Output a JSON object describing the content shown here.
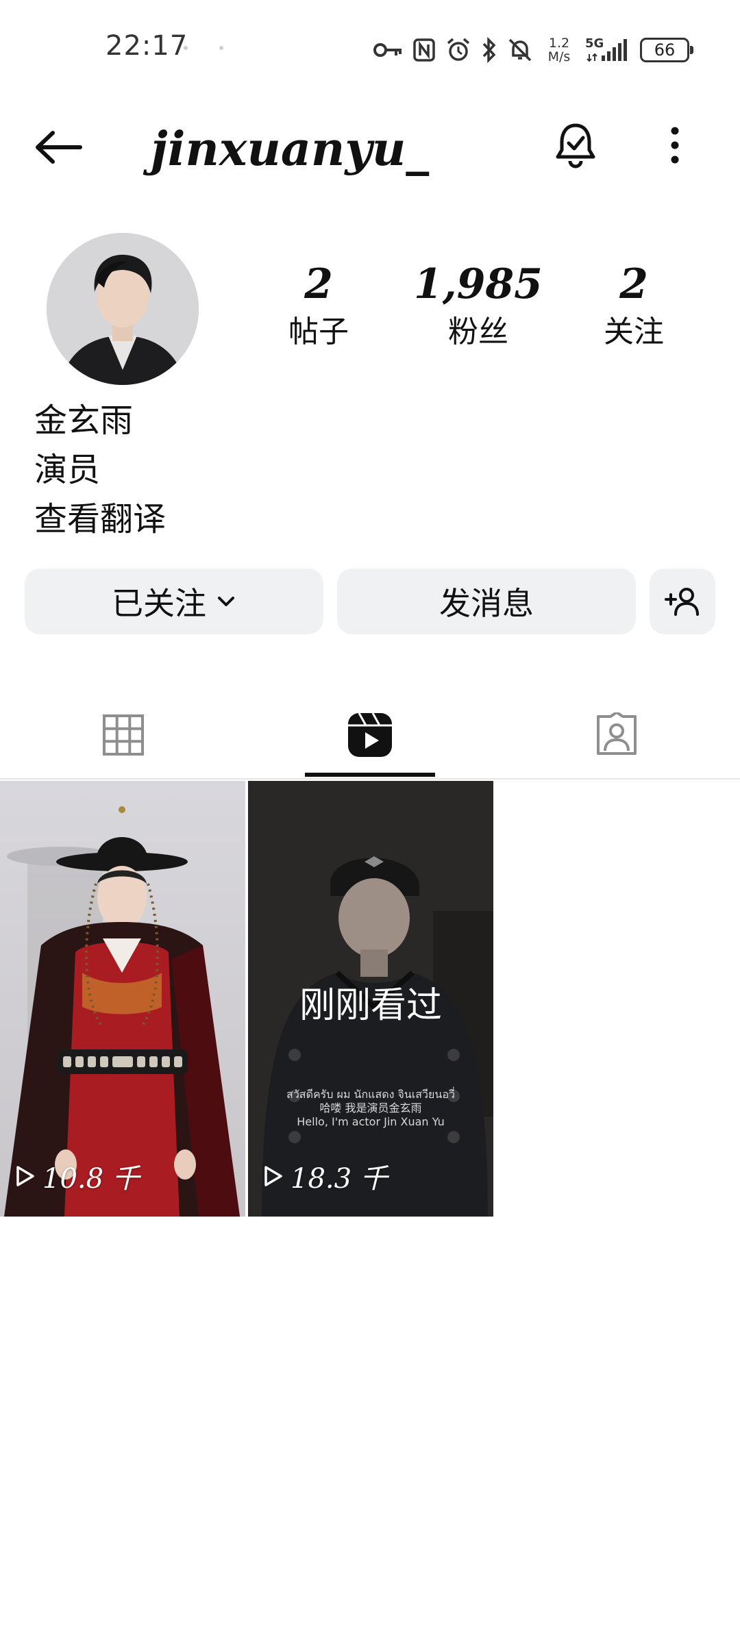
{
  "status_bar": {
    "time": "22:17",
    "net_speed_value": "1.2",
    "net_speed_unit": "M/s",
    "network": "5G",
    "battery": "66"
  },
  "header": {
    "username": "jinxuanyu_"
  },
  "profile": {
    "stats": [
      {
        "value": "2",
        "label": "帖子"
      },
      {
        "value": "1,985",
        "label": "粉丝"
      },
      {
        "value": "2",
        "label": "关注"
      }
    ],
    "bio": {
      "name": "金玄雨",
      "occupation": "演员",
      "translate": "查看翻译"
    }
  },
  "actions": {
    "following_label": "已关注",
    "message_label": "发消息"
  },
  "reels": [
    {
      "views": "10.8 千"
    },
    {
      "views": "18.3 千",
      "overlay": "刚刚看过",
      "subtitle_th": "สวัสดีครับ ผม นักแสดง จินเสวียนอวี่",
      "subtitle_zh": "哈喽 我是演员金玄雨",
      "subtitle_en": "Hello, I'm actor Jin Xuan Yu"
    }
  ],
  "colors": {
    "button_bg": "#eff1f3",
    "text": "#111111",
    "tab_inactive": "#8e8e8e"
  }
}
